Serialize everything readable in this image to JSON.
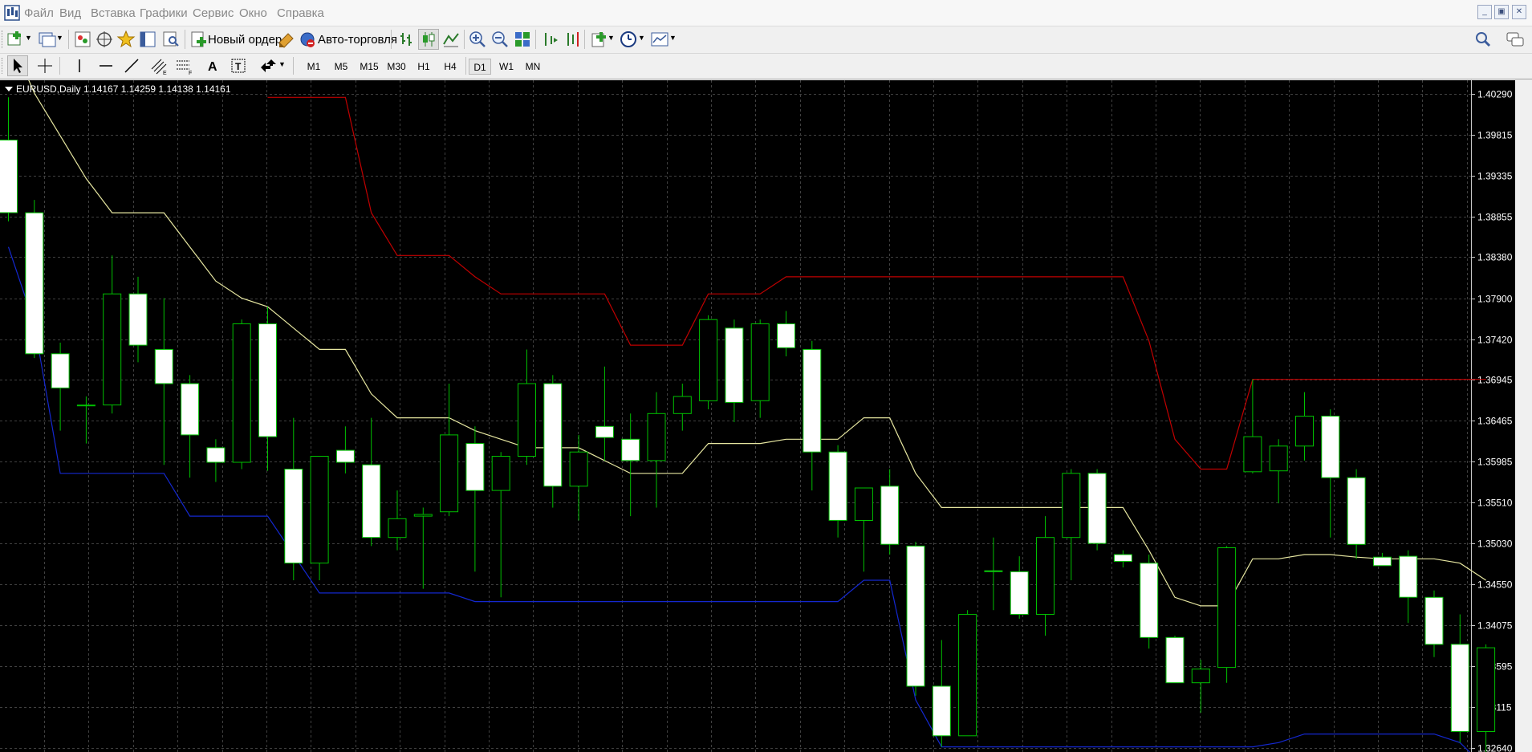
{
  "menu": {
    "items": [
      "Файл",
      "Вид",
      "Вставка",
      "Графики",
      "Сервис",
      "Окно",
      "Справка"
    ]
  },
  "toolbar": {
    "new_order_label": "Новый ордер",
    "autotrade_label": "Авто-торговля"
  },
  "timeframes": [
    "M1",
    "M5",
    "M15",
    "M30",
    "H1",
    "H4",
    "D1",
    "W1",
    "MN"
  ],
  "active_timeframe": "D1",
  "icons": {
    "menu": [
      "app-icon",
      "minimize-icon",
      "restore-icon",
      "close-icon"
    ],
    "toolbar1": [
      "new-chart-icon",
      "profiles-icon",
      "market-watch-icon",
      "data-window-icon",
      "navigator-icon",
      "terminal-icon",
      "strategy-tester-icon",
      "new-order-icon",
      "metaeditor-icon",
      "autotrading-icon",
      "bar-chart-icon",
      "candlestick-icon",
      "line-chart-icon",
      "zoom-in-icon",
      "zoom-out-icon",
      "tile-windows-icon",
      "chart-shift-icon",
      "autoscroll-icon",
      "indicators-icon",
      "periods-icon",
      "templates-icon",
      "search-icon",
      "chat-icon"
    ],
    "toolbar2": [
      "cursor-icon",
      "crosshair-icon",
      "vertical-line-icon",
      "horizontal-line-icon",
      "trendline-icon",
      "equidistant-channel-icon",
      "fibonacci-icon",
      "text-icon",
      "text-label-icon",
      "arrows-icon"
    ]
  },
  "chart": {
    "header": "EURUSD,Daily  1.14167 1.14259 1.14138 1.14161",
    "colors": {
      "background": "#000000",
      "grid": "#404040",
      "bull_body": "#000000",
      "bear_body": "#ffffff",
      "wick": "#00c000",
      "upper_line": "#c00000",
      "middle_line": "#e6e6a0",
      "lower_line": "#1428d0"
    }
  },
  "chart_data": {
    "type": "candlestick",
    "symbol": "EURUSD",
    "timeframe": "Daily",
    "y_ticks": [
      "1.40290",
      "1.39815",
      "1.39335",
      "1.38855",
      "1.38380",
      "1.37900",
      "1.37420",
      "1.36945",
      "1.36465",
      "1.35985",
      "1.35510",
      "1.35030",
      "1.34550",
      "1.34075",
      "1.33595",
      "1.33115",
      "1.32640"
    ],
    "ylim": [
      1.3259,
      1.4045
    ],
    "grid": true,
    "candles": [
      {
        "o": 1.3975,
        "h": 1.4025,
        "l": 1.388,
        "c": 1.389
      },
      {
        "o": 1.389,
        "h": 1.3905,
        "l": 1.372,
        "c": 1.3725
      },
      {
        "o": 1.3725,
        "h": 1.3738,
        "l": 1.3635,
        "c": 1.3685
      },
      {
        "o": 1.3665,
        "h": 1.3675,
        "l": 1.362,
        "c": 1.3665
      },
      {
        "o": 1.3665,
        "h": 1.384,
        "l": 1.3655,
        "c": 1.3795
      },
      {
        "o": 1.3795,
        "h": 1.3815,
        "l": 1.3715,
        "c": 1.3735
      },
      {
        "o": 1.373,
        "h": 1.379,
        "l": 1.3595,
        "c": 1.369
      },
      {
        "o": 1.369,
        "h": 1.37,
        "l": 1.358,
        "c": 1.363
      },
      {
        "o": 1.3615,
        "h": 1.3625,
        "l": 1.3575,
        "c": 1.3598
      },
      {
        "o": 1.3598,
        "h": 1.3765,
        "l": 1.359,
        "c": 1.376
      },
      {
        "o": 1.376,
        "h": 1.378,
        "l": 1.3588,
        "c": 1.3628
      },
      {
        "o": 1.359,
        "h": 1.365,
        "l": 1.346,
        "c": 1.348
      },
      {
        "o": 1.348,
        "h": 1.3605,
        "l": 1.346,
        "c": 1.3605
      },
      {
        "o": 1.3612,
        "h": 1.364,
        "l": 1.3585,
        "c": 1.3598
      },
      {
        "o": 1.3595,
        "h": 1.365,
        "l": 1.35,
        "c": 1.351
      },
      {
        "o": 1.351,
        "h": 1.3565,
        "l": 1.3495,
        "c": 1.3532
      },
      {
        "o": 1.3535,
        "h": 1.3545,
        "l": 1.345,
        "c": 1.3537
      },
      {
        "o": 1.354,
        "h": 1.369,
        "l": 1.3535,
        "c": 1.363
      },
      {
        "o": 1.362,
        "h": 1.364,
        "l": 1.347,
        "c": 1.3565
      },
      {
        "o": 1.3565,
        "h": 1.361,
        "l": 1.344,
        "c": 1.3605
      },
      {
        "o": 1.3605,
        "h": 1.373,
        "l": 1.3595,
        "c": 1.369
      },
      {
        "o": 1.369,
        "h": 1.37,
        "l": 1.3545,
        "c": 1.357
      },
      {
        "o": 1.357,
        "h": 1.363,
        "l": 1.353,
        "c": 1.361
      },
      {
        "o": 1.364,
        "h": 1.371,
        "l": 1.36,
        "c": 1.3627
      },
      {
        "o": 1.3625,
        "h": 1.3655,
        "l": 1.3535,
        "c": 1.36
      },
      {
        "o": 1.36,
        "h": 1.368,
        "l": 1.3545,
        "c": 1.3655
      },
      {
        "o": 1.3655,
        "h": 1.369,
        "l": 1.3635,
        "c": 1.3675
      },
      {
        "o": 1.367,
        "h": 1.377,
        "l": 1.366,
        "c": 1.3765
      },
      {
        "o": 1.3755,
        "h": 1.3765,
        "l": 1.3645,
        "c": 1.3668
      },
      {
        "o": 1.367,
        "h": 1.3765,
        "l": 1.365,
        "c": 1.376
      },
      {
        "o": 1.376,
        "h": 1.3775,
        "l": 1.3722,
        "c": 1.3732
      },
      {
        "o": 1.373,
        "h": 1.374,
        "l": 1.3565,
        "c": 1.361
      },
      {
        "o": 1.361,
        "h": 1.3618,
        "l": 1.351,
        "c": 1.353
      },
      {
        "o": 1.353,
        "h": 1.3565,
        "l": 1.347,
        "c": 1.3568
      },
      {
        "o": 1.357,
        "h": 1.359,
        "l": 1.349,
        "c": 1.3502
      },
      {
        "o": 1.35,
        "h": 1.3505,
        "l": 1.3325,
        "c": 1.3336
      },
      {
        "o": 1.3336,
        "h": 1.339,
        "l": 1.3265,
        "c": 1.3278
      },
      {
        "o": 1.3278,
        "h": 1.3425,
        "l": 1.3278,
        "c": 1.342
      },
      {
        "o": 1.3471,
        "h": 1.351,
        "l": 1.3425,
        "c": 1.347
      },
      {
        "o": 1.347,
        "h": 1.3488,
        "l": 1.3415,
        "c": 1.342
      },
      {
        "o": 1.342,
        "h": 1.3535,
        "l": 1.3395,
        "c": 1.351
      },
      {
        "o": 1.351,
        "h": 1.359,
        "l": 1.346,
        "c": 1.3585
      },
      {
        "o": 1.3585,
        "h": 1.359,
        "l": 1.3495,
        "c": 1.3503
      },
      {
        "o": 1.349,
        "h": 1.3495,
        "l": 1.3475,
        "c": 1.3482
      },
      {
        "o": 1.348,
        "h": 1.349,
        "l": 1.338,
        "c": 1.3393
      },
      {
        "o": 1.3393,
        "h": 1.3395,
        "l": 1.335,
        "c": 1.334
      },
      {
        "o": 1.334,
        "h": 1.3367,
        "l": 1.3305,
        "c": 1.3356
      },
      {
        "o": 1.3358,
        "h": 1.35,
        "l": 1.334,
        "c": 1.3498
      },
      {
        "o": 1.3587,
        "h": 1.3695,
        "l": 1.3585,
        "c": 1.3628
      },
      {
        "o": 1.3588,
        "h": 1.3625,
        "l": 1.355,
        "c": 1.3617
      },
      {
        "o": 1.3617,
        "h": 1.368,
        "l": 1.36,
        "c": 1.3652
      },
      {
        "o": 1.3652,
        "h": 1.366,
        "l": 1.351,
        "c": 1.358
      },
      {
        "o": 1.358,
        "h": 1.359,
        "l": 1.3485,
        "c": 1.3502
      },
      {
        "o": 1.3487,
        "h": 1.3492,
        "l": 1.348,
        "c": 1.3477
      },
      {
        "o": 1.3488,
        "h": 1.3495,
        "l": 1.341,
        "c": 1.344
      },
      {
        "o": 1.344,
        "h": 1.3448,
        "l": 1.337,
        "c": 1.3385
      },
      {
        "o": 1.3385,
        "h": 1.342,
        "l": 1.327,
        "c": 1.3283
      },
      {
        "o": 1.3283,
        "h": 1.3385,
        "l": 1.3255,
        "c": 1.3381
      }
    ],
    "upper_line": [
      null,
      null,
      null,
      null,
      null,
      null,
      null,
      null,
      null,
      null,
      1.4025,
      1.4025,
      1.4025,
      1.4025,
      1.389,
      1.384,
      1.384,
      1.384,
      1.3815,
      1.3795,
      1.3795,
      1.3795,
      1.3795,
      1.3795,
      1.3735,
      1.3735,
      1.3735,
      1.3795,
      1.3795,
      1.3795,
      1.3815,
      1.3815,
      1.3815,
      1.3815,
      1.3815,
      1.3815,
      1.3815,
      1.3815,
      1.3815,
      1.3815,
      1.3815,
      1.3815,
      1.3815,
      1.3815,
      1.374,
      1.3625,
      1.359,
      1.359,
      1.3695,
      1.3695,
      1.3695,
      1.3695,
      1.3695,
      1.3695,
      1.3695,
      1.3695,
      1.3695,
      1.3695
    ],
    "middle_line": [
      1.41,
      1.403,
      1.398,
      1.393,
      1.389,
      1.389,
      1.389,
      1.385,
      1.381,
      1.379,
      1.378,
      1.3755,
      1.373,
      1.373,
      1.3678,
      1.365,
      1.365,
      1.365,
      1.3635,
      1.3625,
      1.3615,
      1.3615,
      1.3615,
      1.36,
      1.3585,
      1.3585,
      1.3585,
      1.362,
      1.362,
      1.362,
      1.3625,
      1.3625,
      1.3625,
      1.365,
      1.365,
      1.3585,
      1.3545,
      1.3545,
      1.3545,
      1.3545,
      1.3545,
      1.3545,
      1.3545,
      1.3545,
      1.3495,
      1.344,
      1.343,
      1.343,
      1.3485,
      1.3485,
      1.349,
      1.349,
      1.3487,
      1.3485,
      1.3485,
      1.3485,
      1.348,
      1.346
    ],
    "lower_line": [
      1.385,
      1.376,
      1.3585,
      1.3585,
      1.3585,
      1.3585,
      1.3585,
      1.3535,
      1.3535,
      1.3535,
      1.3535,
      1.349,
      1.3445,
      1.3445,
      1.3445,
      1.3445,
      1.3445,
      1.3445,
      1.3435,
      1.3435,
      1.3435,
      1.3435,
      1.3435,
      1.3435,
      1.3435,
      1.3435,
      1.3435,
      1.3435,
      1.3435,
      1.3435,
      1.3435,
      1.3435,
      1.3435,
      1.346,
      1.346,
      1.332,
      1.3265,
      1.3265,
      1.3265,
      1.3265,
      1.3265,
      1.3265,
      1.3265,
      1.3265,
      1.3265,
      1.3265,
      1.3265,
      1.3265,
      1.3265,
      1.327,
      1.328,
      1.328,
      1.328,
      1.328,
      1.328,
      1.328,
      1.327,
      1.324
    ]
  }
}
